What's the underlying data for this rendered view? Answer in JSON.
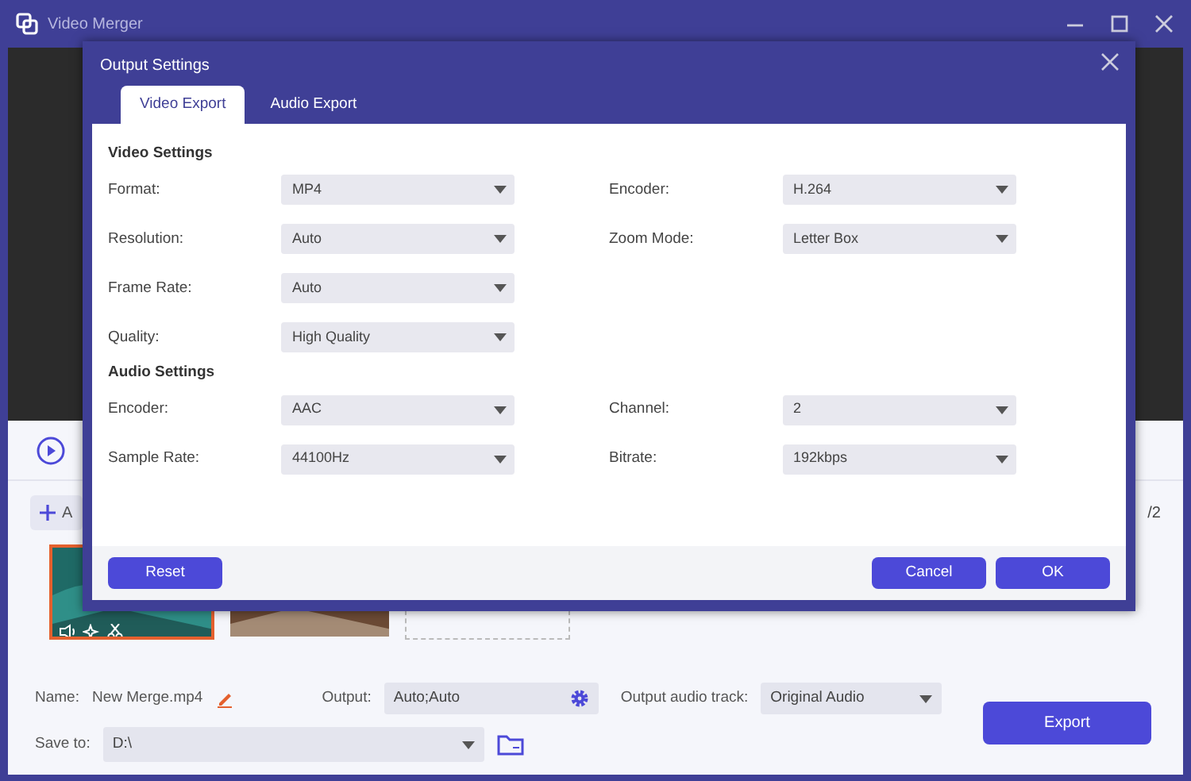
{
  "window": {
    "title": "Video Merger"
  },
  "clip_area": {
    "add_label": "A",
    "page_count": "/2",
    "clips": [
      {
        "kind": "picture",
        "selected": true
      },
      {
        "kind": "picture",
        "selected": false
      },
      {
        "kind": "empty"
      }
    ]
  },
  "bottom_bar": {
    "name_label": "Name:",
    "name_value": "New Merge.mp4",
    "output_label": "Output:",
    "output_value": "Auto;Auto",
    "audio_label": "Output audio track:",
    "audio_value": "Original Audio",
    "save_label": "Save to:",
    "save_value": "D:\\",
    "export": "Export"
  },
  "dialog": {
    "title": "Output Settings",
    "tabs": [
      {
        "label": "Video Export",
        "selected": true
      },
      {
        "label": "Audio Export",
        "selected": false
      }
    ],
    "sections": [
      {
        "title": "Video Settings",
        "rows": [
          {
            "left": {
              "label": "Format:",
              "value": "MP4"
            },
            "right": {
              "label": "Encoder:",
              "value": "H.264"
            }
          },
          {
            "left": {
              "label": "Resolution:",
              "value": "Auto"
            },
            "right": {
              "label": "Zoom Mode:",
              "value": "Letter Box"
            }
          },
          {
            "left": {
              "label": "Frame Rate:",
              "value": "Auto"
            }
          },
          {
            "left": {
              "label": "Quality:",
              "value": "High Quality"
            }
          }
        ]
      },
      {
        "title": "Audio Settings",
        "rows": [
          {
            "left": {
              "label": "Encoder:",
              "value": "AAC"
            },
            "right": {
              "label": "Channel:",
              "value": "2"
            }
          },
          {
            "left": {
              "label": "Sample Rate:",
              "value": "44100Hz"
            },
            "right": {
              "label": "Bitrate:",
              "value": "192kbps"
            }
          }
        ]
      }
    ],
    "buttons": {
      "reset": "Reset",
      "cancel": "Cancel",
      "ok": "OK"
    }
  }
}
